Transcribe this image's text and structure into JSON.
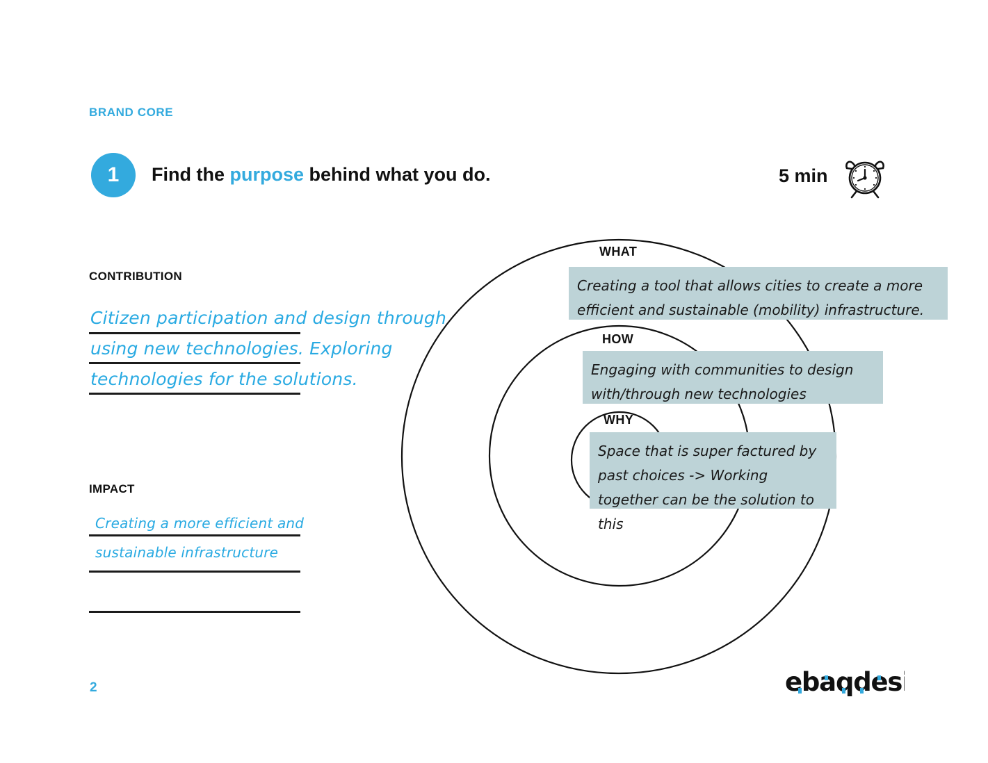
{
  "header": {
    "eyebrow": "BRAND CORE",
    "step_number": "1",
    "title_pre": "Find the ",
    "title_accent": "purpose",
    "title_post": " behind what you do.",
    "timer_label": "5 min",
    "timer_icon": "alarm-clock-icon",
    "accent_color": "#33aade"
  },
  "left_panel": {
    "contribution": {
      "label": "CONTRIBUTION",
      "lines": [
        "Citizen participation and design through",
        "using new technologies. Exploring",
        "technologies for the solutions."
      ]
    },
    "impact": {
      "label": "IMPACT",
      "lines": [
        "Creating a more efficient and",
        "sustainable infrastructure"
      ]
    }
  },
  "diagram": {
    "type": "golden-circle",
    "note_color": "#bdd3d7",
    "rings": [
      {
        "label": "WHAT",
        "note": "Creating a tool that allows cities to create a more efficient and sustainable (mobility) infrastructure."
      },
      {
        "label": "HOW",
        "note": "Engaging with communities to design with/through new technologies"
      },
      {
        "label": "WHY",
        "note": "Space that is super factured by past choices -> Working together can be the solution to this"
      }
    ]
  },
  "footer": {
    "page_number": "2",
    "logo_text": "ebaqdesign"
  }
}
